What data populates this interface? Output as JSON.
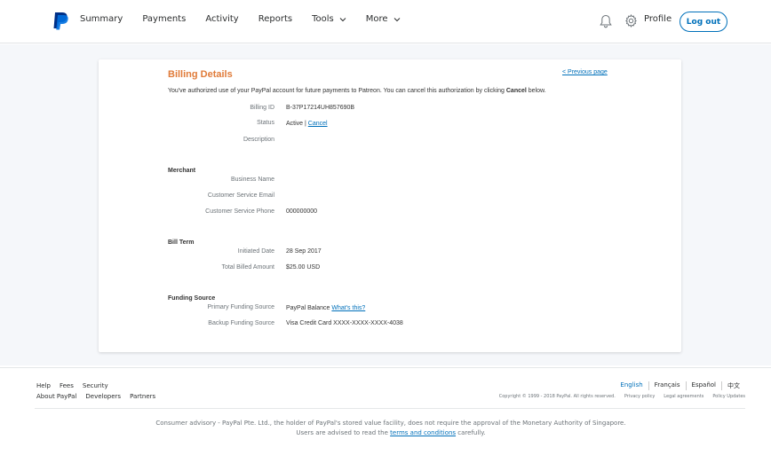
{
  "header": {
    "nav": [
      {
        "label": "Summary",
        "dropdown": false
      },
      {
        "label": "Payments",
        "dropdown": false
      },
      {
        "label": "Activity",
        "dropdown": false
      },
      {
        "label": "Reports",
        "dropdown": false
      },
      {
        "label": "Tools",
        "dropdown": true
      },
      {
        "label": "More",
        "dropdown": true
      }
    ],
    "profile_label": "Profile",
    "logout_label": "Log out",
    "brand_color": "#0070ba"
  },
  "billing": {
    "title": "Billing Details",
    "previous_link": "< Previous page",
    "intro_text": "You've authorized use of your PayPal account for future payments to Patreon. You can cancel this authorization by clicking ",
    "intro_bold": "Cancel",
    "intro_end": " below.",
    "billing_id_label": "Billing ID",
    "billing_id_value": "B-37P17214UH857690B",
    "status_label": "Status",
    "status_value": "Active | ",
    "status_cancel_link": "Cancel",
    "description_label": "Description",
    "merchant_heading": "Merchant",
    "business_name_label": "Business Name",
    "cs_email_label": "Customer Service Email",
    "cs_phone_label": "Customer Service Phone",
    "cs_phone_value": "000000000",
    "bill_term_heading": "Bill Term",
    "initiated_label": "Initiated Date",
    "initiated_value": "28 Sep 2017",
    "total_label": "Total Billed Amount",
    "total_value": "$25.00 USD",
    "funding_heading": "Funding Source",
    "primary_label": "Primary Funding Source",
    "primary_value": "PayPal Balance ",
    "primary_link": "What's this?",
    "backup_label": "Backup Funding Source",
    "backup_value": "Visa Credit Card XXXX-XXXX-XXXX-4038"
  },
  "footer": {
    "links_row1": [
      "Help",
      "Fees",
      "Security"
    ],
    "links_row2": [
      "About PayPal",
      "Developers",
      "Partners"
    ],
    "languages": [
      "English",
      "Français",
      "Español",
      "中文"
    ],
    "copyright": "Copyright © 1999 - 2018 PayPal. All rights reserved.",
    "legal_links": [
      "Privacy policy",
      "Legal agreements",
      "Policy Updates"
    ],
    "advisory_text": "Consumer advisory - PayPal Pte. Ltd., the holder of PayPal's stored value facility, does not require the approval of the Monetary Authority of Singapore. Users are advised to read the ",
    "advisory_link": "terms and conditions",
    "advisory_end": " carefully."
  }
}
